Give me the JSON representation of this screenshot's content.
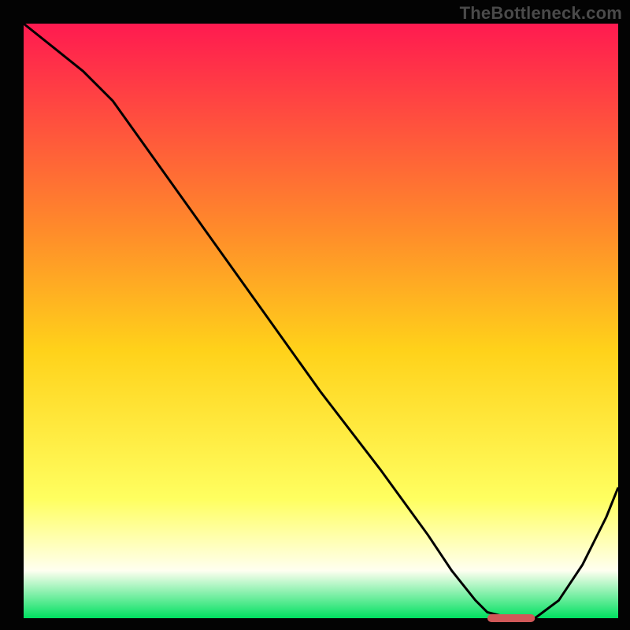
{
  "watermark": "TheBottleneck.com",
  "colors": {
    "top": "#ff1a50",
    "mid_upper": "#ff8c2a",
    "mid": "#ffd21a",
    "mid_lower": "#ffff60",
    "lower": "#fffff0",
    "bottom": "#00e060",
    "curve": "#000000",
    "marker": "#d05858",
    "frame": "#050505",
    "bg_outer": "#030303"
  },
  "layout": {
    "outer_w": 800,
    "outer_h": 800,
    "inner_x": 30,
    "inner_y": 30,
    "inner_w": 755,
    "inner_h": 755
  },
  "chart_data": {
    "type": "line",
    "title": "",
    "xlabel": "",
    "ylabel": "",
    "xlim": [
      0,
      100
    ],
    "ylim": [
      0,
      100
    ],
    "x": [
      0,
      5,
      10,
      15,
      20,
      30,
      40,
      50,
      60,
      68,
      72,
      76,
      78,
      82,
      86,
      90,
      94,
      98,
      100
    ],
    "y": [
      100,
      96,
      92,
      87,
      80,
      66,
      52,
      38,
      25,
      14,
      8,
      3,
      1,
      0,
      0,
      3,
      9,
      17,
      22
    ],
    "marker": {
      "x_start": 78,
      "x_end": 86,
      "y": 0
    },
    "gradient_stops": [
      {
        "offset": 0.0,
        "color_key": "top"
      },
      {
        "offset": 0.35,
        "color_key": "mid_upper"
      },
      {
        "offset": 0.55,
        "color_key": "mid"
      },
      {
        "offset": 0.8,
        "color_key": "mid_lower"
      },
      {
        "offset": 0.92,
        "color_key": "lower"
      },
      {
        "offset": 1.0,
        "color_key": "bottom"
      }
    ]
  }
}
